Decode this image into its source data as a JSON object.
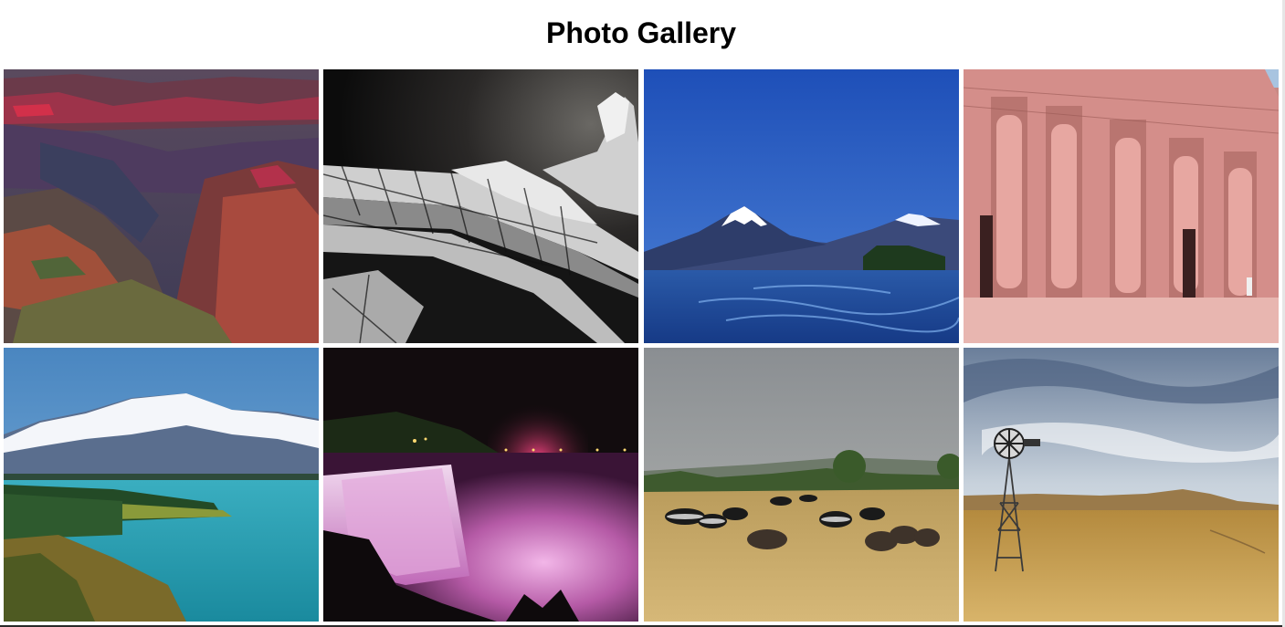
{
  "page": {
    "title": "Photo Gallery"
  },
  "gallery": {
    "photos": [
      {
        "subject": "canyon",
        "icon": "canyon-photo"
      },
      {
        "subject": "eiffel-tower",
        "icon": "eiffel-tower-photo"
      },
      {
        "subject": "volcano-lake",
        "icon": "volcano-lake-photo"
      },
      {
        "subject": "egyptian-temple",
        "icon": "temple-photo"
      },
      {
        "subject": "mountain-lake",
        "icon": "mountain-lake-photo"
      },
      {
        "subject": "waterfall-night",
        "icon": "waterfall-photo"
      },
      {
        "subject": "savanna-zebras",
        "icon": "savanna-photo"
      },
      {
        "subject": "windmill-prairie",
        "icon": "windmill-photo"
      }
    ]
  },
  "colors": {
    "background": "#ffffff",
    "title": "#000000"
  }
}
